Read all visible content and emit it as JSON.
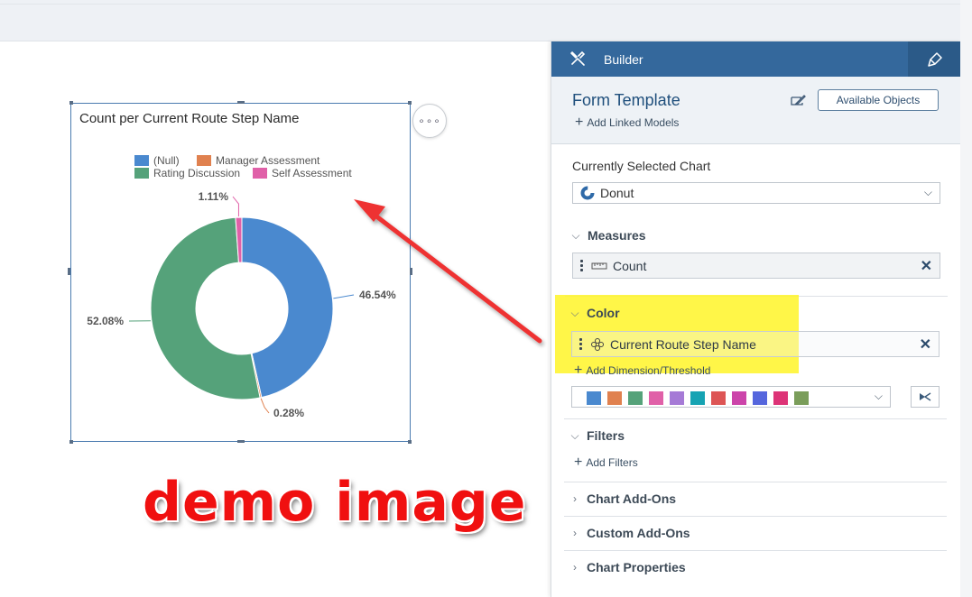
{
  "chart": {
    "title": "Count per Current Route Step Name",
    "more_label": "∘∘∘"
  },
  "chart_data": {
    "type": "pie",
    "title": "Count per Current Route Step Name",
    "categories": [
      "(Null)",
      "Manager Assessment",
      "Rating Discussion",
      "Self Assessment"
    ],
    "values": [
      46.54,
      0.28,
      52.08,
      1.11
    ],
    "data_labels": [
      "46.54%",
      "0.28%",
      "52.08%",
      "1.11%"
    ],
    "colors": [
      "#4a89cf",
      "#e0814f",
      "#55a27a",
      "#e060a8"
    ],
    "legend": "top"
  },
  "overlay": {
    "demo_text": "demo image",
    "arrow_color": "#ee3333"
  },
  "panel": {
    "header_title": "Builder",
    "form_title": "Form Template",
    "add_linked_models": "Add Linked Models",
    "available_objects": "Available Objects",
    "currently_selected_label": "Currently Selected Chart",
    "chart_type_value": "Donut",
    "measures": {
      "label": "Measures",
      "token": "Count"
    },
    "color": {
      "label": "Color",
      "token": "Current Route Step Name",
      "add_dimension": "Add Dimension/Threshold",
      "palette": [
        "#4a89cf",
        "#e0814f",
        "#55a27a",
        "#e060a8",
        "#a57ad6",
        "#16a3b3",
        "#dd5555",
        "#cc44aa",
        "#5566dd",
        "#dd3377",
        "#7a9d5a"
      ]
    },
    "filters": {
      "label": "Filters",
      "add": "Add Filters"
    },
    "chart_addons": "Chart Add-Ons",
    "custom_addons": "Custom Add-Ons",
    "chart_properties": "Chart Properties"
  }
}
